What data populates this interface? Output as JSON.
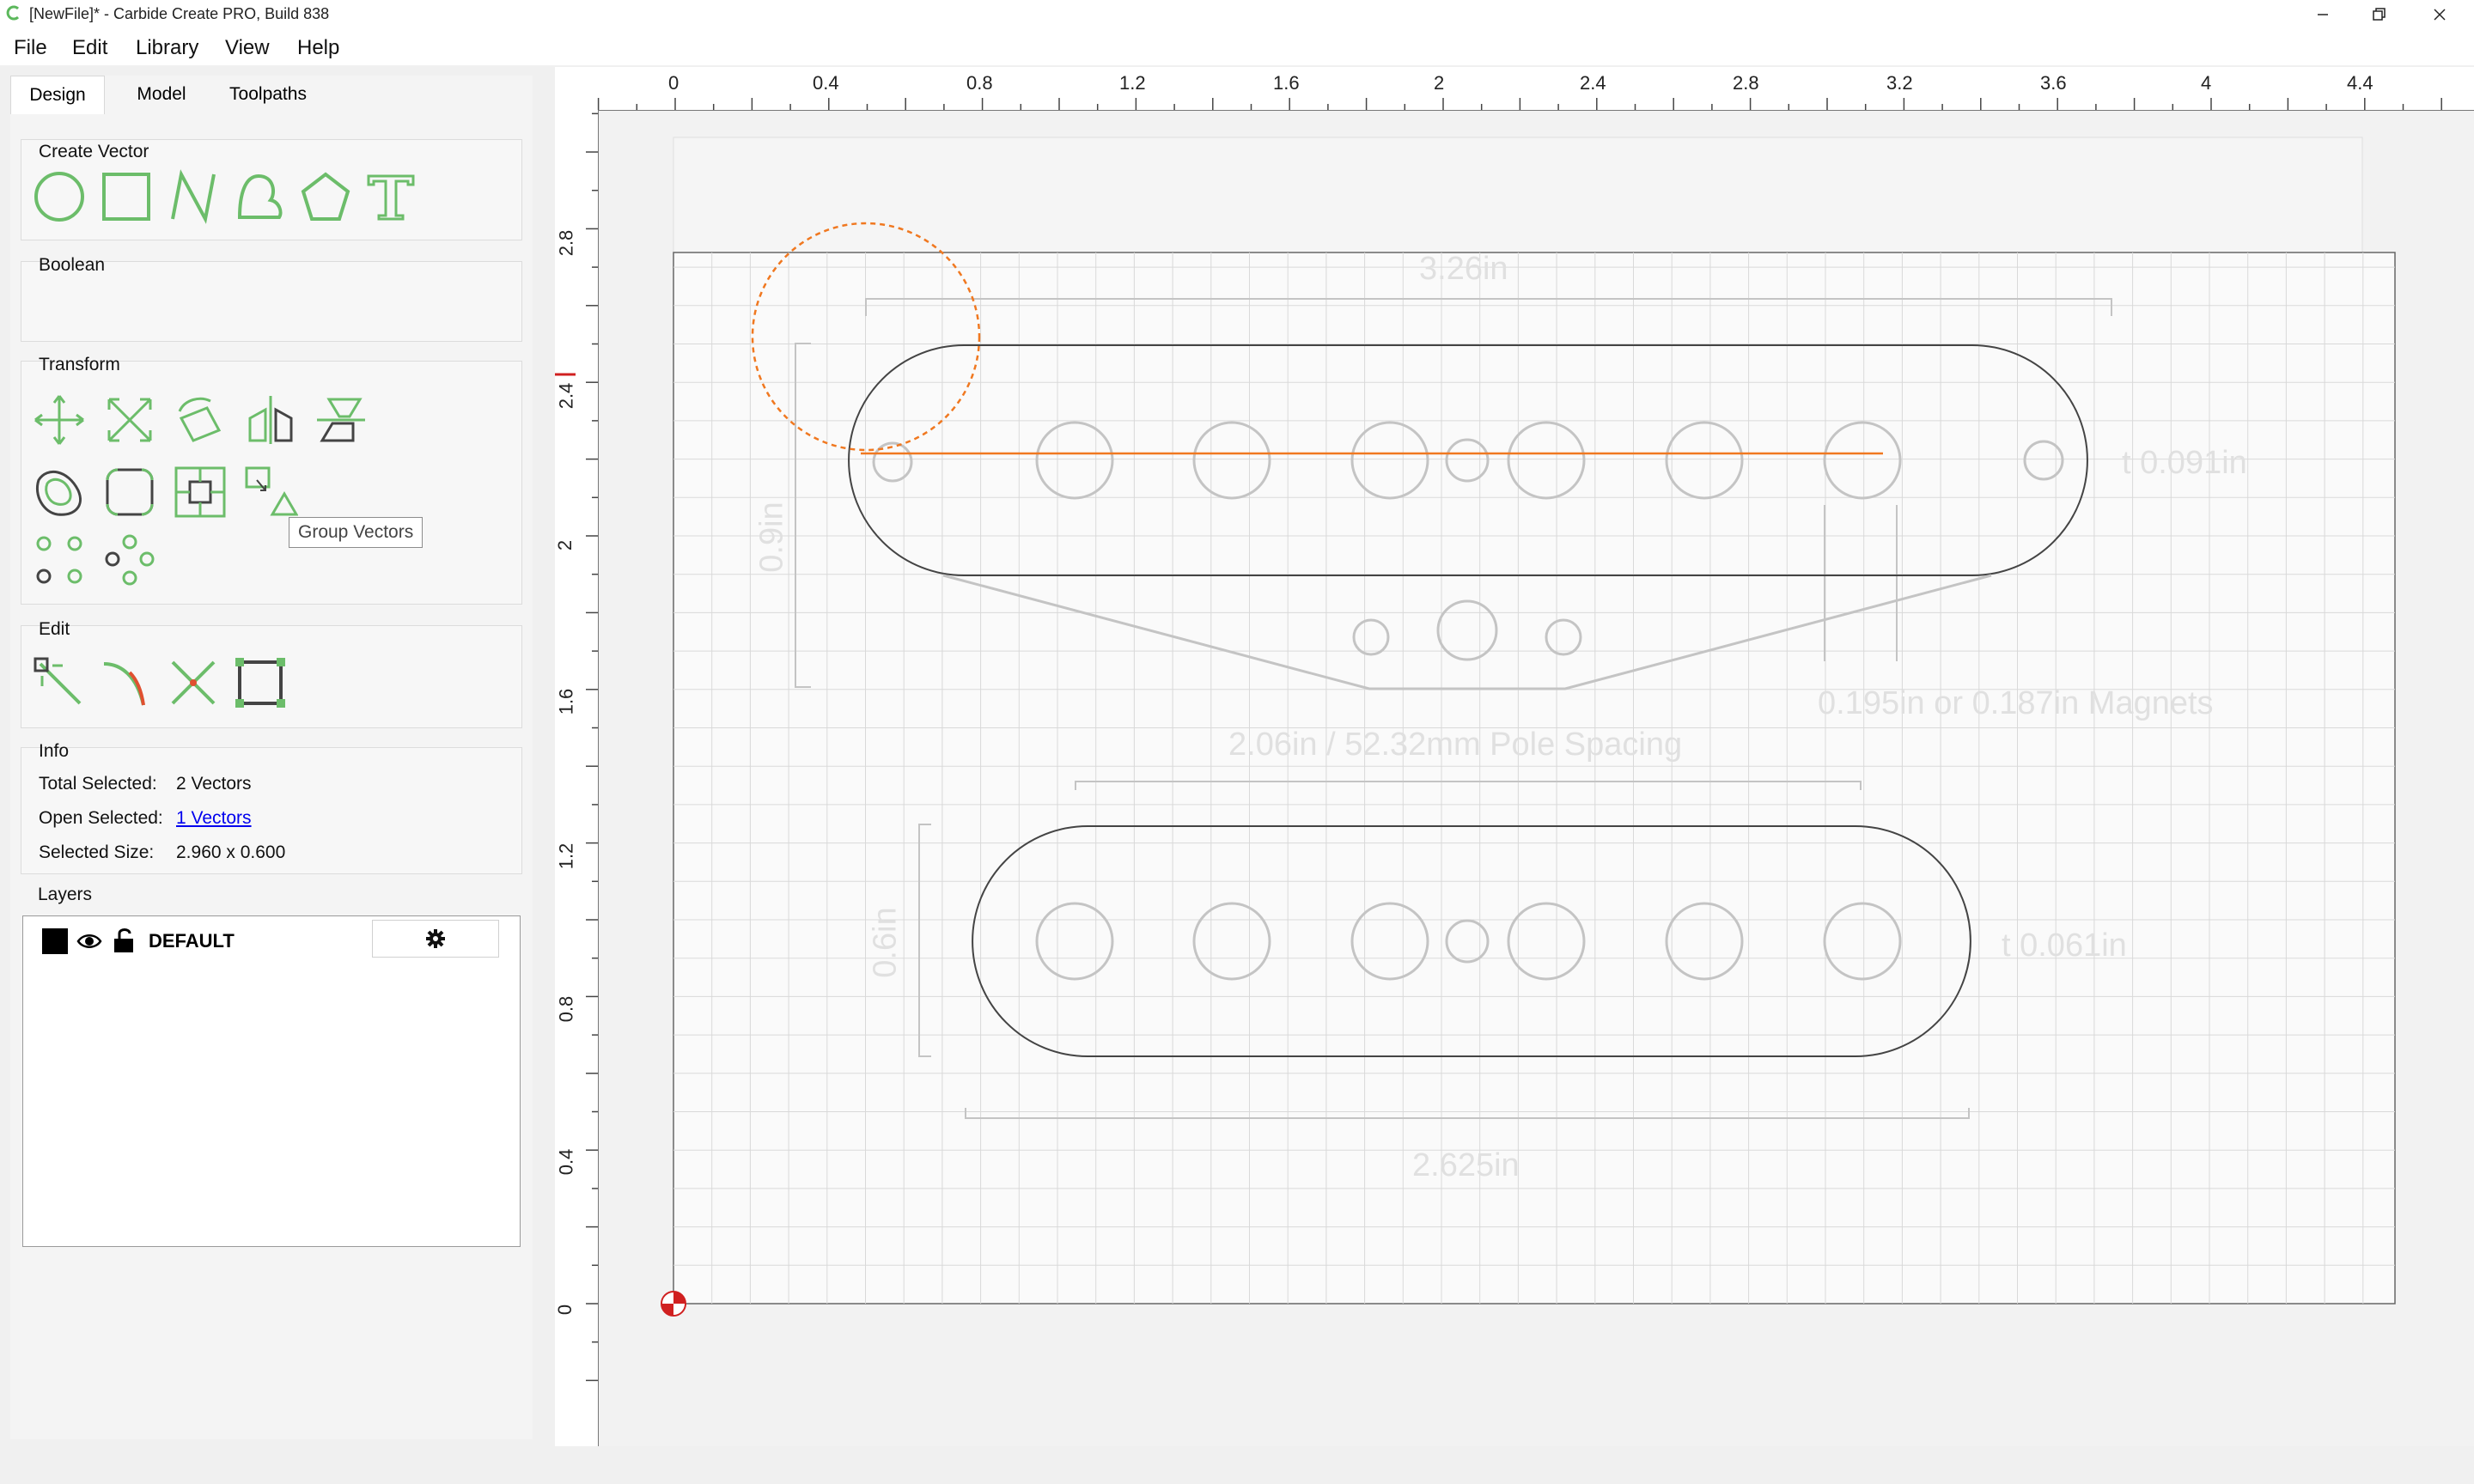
{
  "window": {
    "title": "[NewFile]* - Carbide Create PRO, Build 838",
    "minimize_icon": "minimize-icon",
    "maximize_icon": "restore-icon",
    "close_icon": "close-icon"
  },
  "menu": {
    "items": [
      "File",
      "Edit",
      "Library",
      "View",
      "Help"
    ]
  },
  "tabs": [
    {
      "label": "Design",
      "active": true
    },
    {
      "label": "Model",
      "active": false
    },
    {
      "label": "Toolpaths",
      "active": false
    }
  ],
  "panel": {
    "create_vector": {
      "title": "Create Vector",
      "tools": [
        "circle-icon",
        "rectangle-icon",
        "polyline-icon",
        "curve-icon",
        "polygon-icon",
        "text-icon"
      ]
    },
    "boolean": {
      "title": "Boolean"
    },
    "transform": {
      "title": "Transform",
      "tools": [
        "move-icon",
        "scale-icon",
        "rotate-icon",
        "mirror-icon",
        "align-icon",
        "offset-icon",
        "fillet-icon",
        "center-icon",
        "group-icon",
        "circular-array-icon",
        "linear-array-icon"
      ],
      "tooltip": "Group Vectors"
    },
    "edit": {
      "title": "Edit",
      "tools": [
        "node-edit-icon",
        "trim-icon",
        "split-icon",
        "bounding-box-icon"
      ]
    },
    "info": {
      "title": "Info",
      "total_selected_label": "Total Selected:",
      "total_selected_value": "2 Vectors",
      "open_selected_label": "Open Selected:",
      "open_selected_value": "1 Vectors",
      "selected_size_label": "Selected Size:",
      "selected_size_value": "2.960 x 0.600"
    },
    "layers": {
      "title": "Layers",
      "rows": [
        {
          "name": "DEFAULT",
          "color": "#000000",
          "visible_icon": "eye-icon",
          "lock_icon": "unlock-icon",
          "settings_icon": "gear-icon"
        }
      ]
    }
  },
  "rulers": {
    "top_labels": [
      "0",
      "0.4",
      "0.8",
      "1.2",
      "1.6",
      "2",
      "2.4",
      "2.8",
      "3.2",
      "3.6",
      "4",
      "4.4"
    ],
    "left_labels": [
      "2.8",
      "2.4",
      "2",
      "1.6",
      "1.2",
      "0.8",
      "0.4",
      "0"
    ]
  },
  "canvas": {
    "annotations": {
      "top_width": "3.26in",
      "top_height": "0.9in",
      "top_thickness": "t 0.091in",
      "magnets": "0.195in or 0.187in Magnets",
      "pole_spacing": "2.06in / 52.32mm Pole Spacing",
      "bottom_height": "0.6in",
      "bottom_thickness": "t 0.061in",
      "bottom_width": "2.625in"
    },
    "colors": {
      "grid": "#d9d9d9",
      "outline": "#444444",
      "faint_line": "#c4c4c4",
      "faint_text": "#e0e0e0",
      "selection": "#f07820",
      "accent_green": "#6cbd6a"
    }
  }
}
